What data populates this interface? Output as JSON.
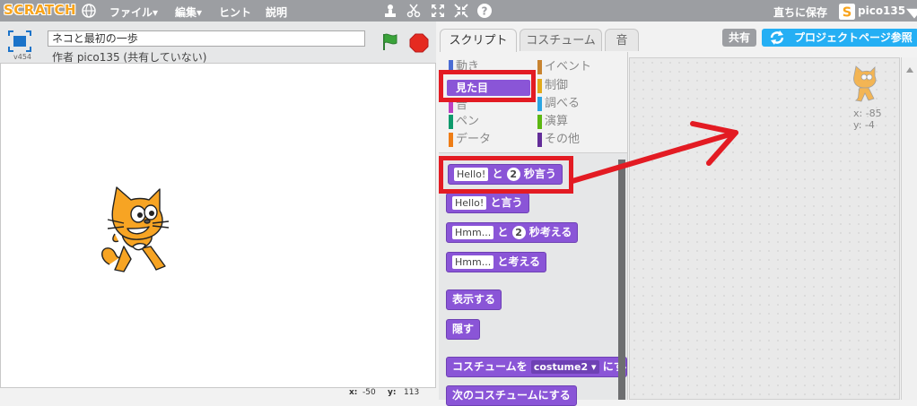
{
  "menu": {
    "logo": "SCRATCH",
    "file": "ファイル▾",
    "edit": "編集▾",
    "tips": "ヒント",
    "about": "説明",
    "save_now": "直ちに保存",
    "username": "pico135"
  },
  "stage": {
    "version": "v454",
    "project_title": "ネコと最初の一歩",
    "author": "作者 pico135 (共有していない)",
    "mouse_x_label": "x:",
    "mouse_x": "-50",
    "mouse_y_label": "y:",
    "mouse_y": "113"
  },
  "tabs": [
    "スクリプト",
    "コスチューム",
    "音"
  ],
  "header_buttons": {
    "share": "共有",
    "project_page": "プロジェクトページ参照"
  },
  "categories": [
    {
      "label": "動き",
      "color": "#4a6cd4"
    },
    {
      "label": "見た目",
      "color": "#8a55d7",
      "selected": true
    },
    {
      "label": "音",
      "color": "#bb42c3"
    },
    {
      "label": "ペン",
      "color": "#0e9a6c"
    },
    {
      "label": "データ",
      "color": "#ee7d16"
    },
    {
      "label": "イベント",
      "color": "#c88330"
    },
    {
      "label": "制御",
      "color": "#e1a91a"
    },
    {
      "label": "調べる",
      "color": "#2ca5e2"
    },
    {
      "label": "演算",
      "color": "#5cb712"
    },
    {
      "label": "その他",
      "color": "#632d99"
    }
  ],
  "blocks": {
    "say_secs": {
      "input": "Hello!",
      "mid": "と",
      "num": "2",
      "tail": "秒言う"
    },
    "say": {
      "input": "Hello!",
      "tail": "と言う"
    },
    "think_secs": {
      "input": "Hmm...",
      "mid": "と",
      "num": "2",
      "tail": "秒考える"
    },
    "think": {
      "input": "Hmm...",
      "tail": "と考える"
    },
    "show": "表示する",
    "hide": "隠す",
    "switch_costume": {
      "head": "コスチュームを",
      "dropdown": "costume2 ▾",
      "tail": "にする"
    },
    "next_costume": "次のコスチュームにする"
  },
  "sprite_info": {
    "x": "x: -85",
    "y": "y: -4"
  },
  "colors": {
    "looks": "#8a55d7",
    "annotation": "#e31b23",
    "topbar": "#9c9ea2",
    "project_page": "#25aff4"
  }
}
